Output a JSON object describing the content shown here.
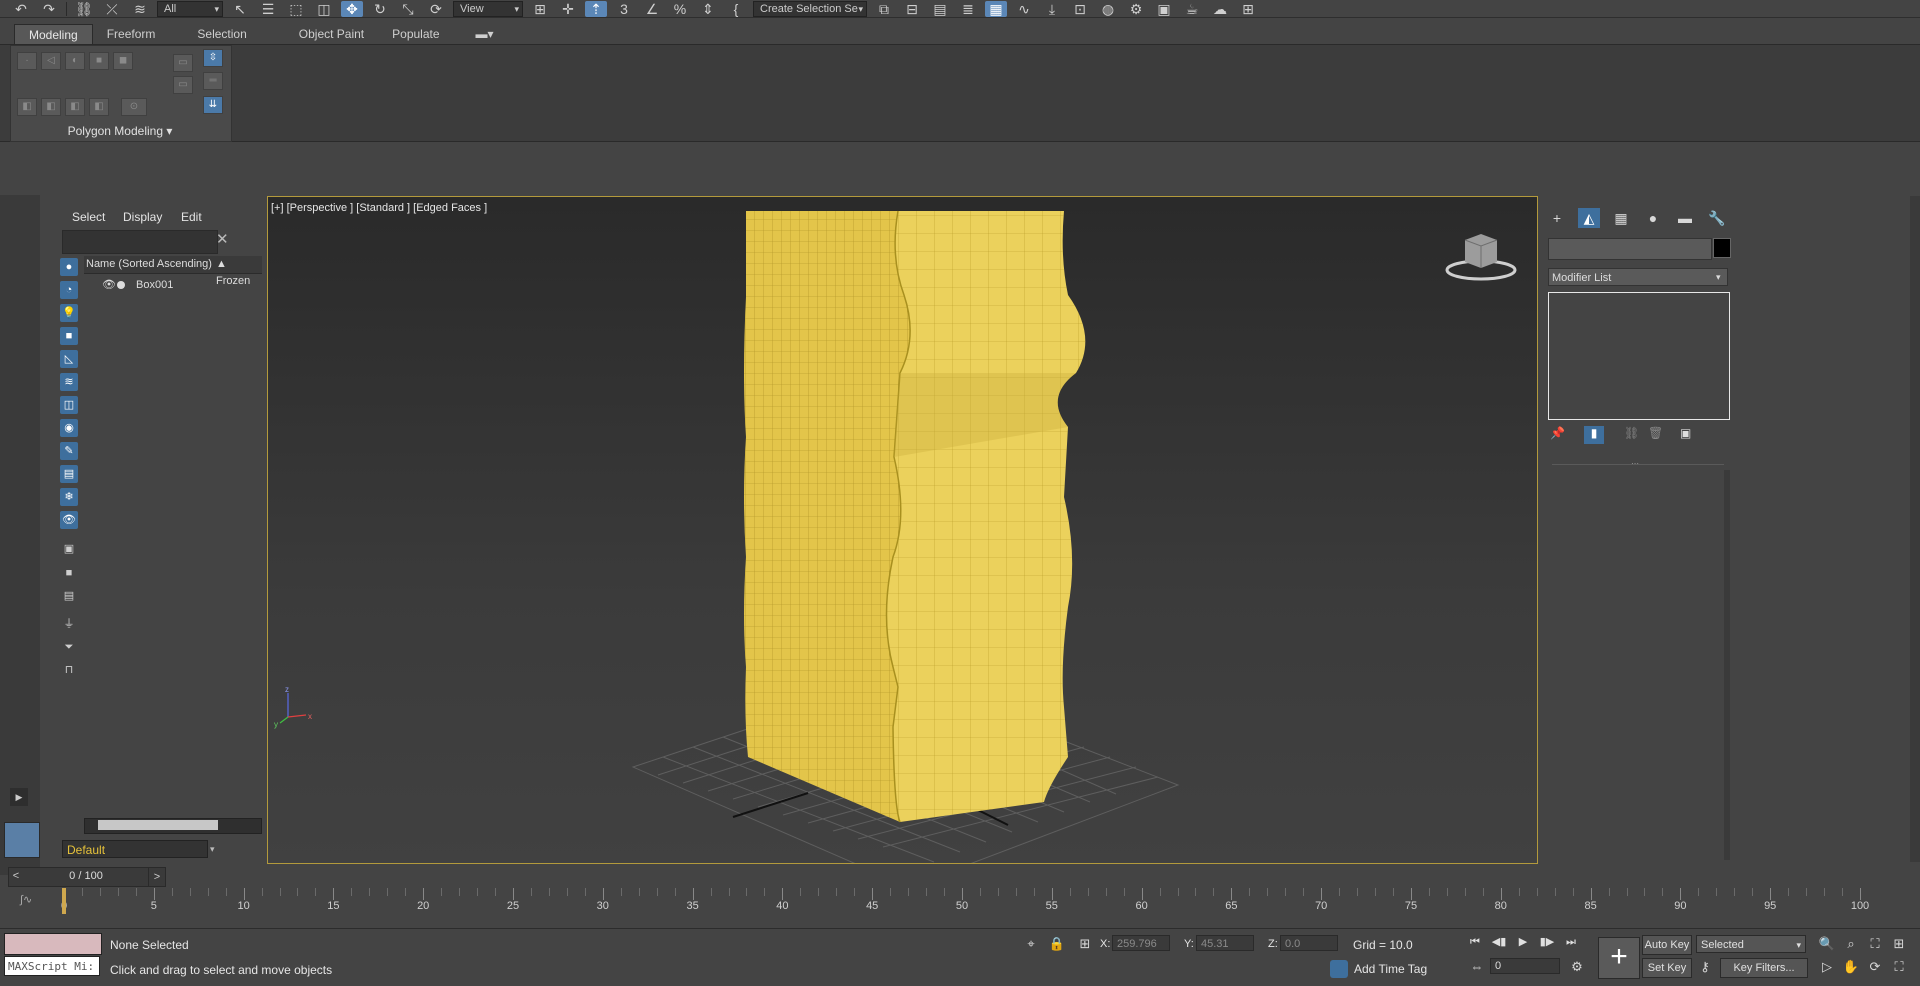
{
  "toolbar": {
    "selection_filter": "All",
    "ref_coord_system": "View",
    "named_selection": "Create Selection Se",
    "icons": [
      "undo-icon",
      "redo-icon",
      "link-icon",
      "unlink-icon",
      "bind-spacewarp-icon",
      "select-object-icon",
      "select-by-name-icon",
      "rect-selection-icon",
      "window-crossing-icon",
      "move-icon",
      "rotate-icon",
      "scale-icon",
      "place-icon",
      "pivot-icon",
      "snap-3d-icon",
      "angle-snap-icon",
      "percent-snap-icon",
      "spinner-snap-icon",
      "edit-named-sel-icon",
      "mirror-icon",
      "align-icon",
      "scene-explorer-icon",
      "layer-explorer-icon",
      "ribbon-toggle-icon",
      "curve-editor-icon",
      "schematic-view-icon",
      "material-editor-icon",
      "render-setup-icon",
      "render-frame-icon",
      "render-icon",
      "render-cloud-icon",
      "a360-icon"
    ]
  },
  "ribbon": {
    "tabs": [
      {
        "label": "Modeling",
        "active": true
      },
      {
        "label": "Freeform",
        "active": false
      },
      {
        "label": "Selection",
        "active": false
      },
      {
        "label": "Object Paint",
        "active": false
      },
      {
        "label": "Populate",
        "active": false
      }
    ],
    "group_label": "Polygon Modeling"
  },
  "scene_explorer": {
    "menus": [
      "Select",
      "Display",
      "Edit"
    ],
    "search_placeholder": "",
    "column_name": "Name (Sorted Ascending)",
    "column_frozen": "▲ Frozen",
    "objects": [
      {
        "name": "Box001"
      }
    ],
    "layer": "Default"
  },
  "viewport": {
    "label": "[+] [Perspective ] [Standard ] [Edged Faces ]",
    "object_color": "#e3c54a",
    "axis": {
      "x": "x",
      "y": "y",
      "z": "z"
    }
  },
  "command_panel": {
    "tabs": [
      "create-icon",
      "modify-icon",
      "hierarchy-icon",
      "motion-icon",
      "display-icon",
      "utilities-icon"
    ],
    "object_name": "",
    "object_color": "#000000",
    "modifier_list": "Modifier List"
  },
  "time_slider": {
    "label": "0 / 100",
    "prev": "<",
    "next": ">"
  },
  "trackbar": {
    "ticks": [
      "0",
      "5",
      "10",
      "15",
      "20",
      "25",
      "30",
      "35",
      "40",
      "45",
      "50",
      "55",
      "60",
      "65",
      "70",
      "75",
      "80",
      "85",
      "90",
      "95",
      "100"
    ]
  },
  "status": {
    "maxscript": "MAXScript Mi:",
    "selection": "None Selected",
    "prompt": "Click and drag to select and move objects",
    "x_label": "X:",
    "x_value": "259.796",
    "y_label": "Y:",
    "y_value": "45.31",
    "z_label": "Z:",
    "z_value": "0.0",
    "grid": "Grid = 10.0",
    "add_time_tag": "Add Time Tag",
    "current_frame": "0",
    "auto_key": "Auto Key",
    "set_key": "Set Key",
    "key_set": "Selected",
    "key_filters": "Key Filters..."
  }
}
